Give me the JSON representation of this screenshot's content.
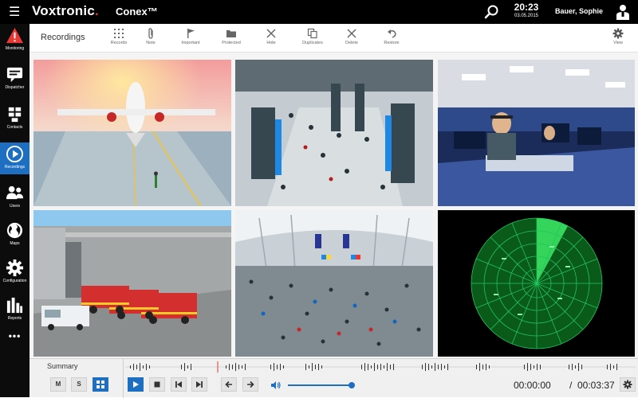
{
  "header": {
    "brand_name": "Voxtronic",
    "brand_dot": ".",
    "product": "Conex™",
    "time": "20:23",
    "date": "03.05.2015",
    "user": "Bauer, Sophie",
    "menu_icon": "hamburger-icon",
    "search_icon": "search-icon",
    "user_icon": "user-icon"
  },
  "sidebar": {
    "items": [
      {
        "label": "Monitoring",
        "icon": "alert-icon",
        "active": false
      },
      {
        "label": "Dispatcher",
        "icon": "chat-icon",
        "active": false
      },
      {
        "label": "Contacts",
        "icon": "contacts-icon",
        "active": false
      },
      {
        "label": "Recordings",
        "icon": "play-circle-icon",
        "active": true
      },
      {
        "label": "Users",
        "icon": "users-icon",
        "active": false
      },
      {
        "label": "Maps",
        "icon": "globe-icon",
        "active": false
      },
      {
        "label": "Configuration",
        "icon": "gear-icon",
        "active": false
      },
      {
        "label": "Reports",
        "icon": "bar-chart-icon",
        "active": false
      }
    ],
    "more": "•••"
  },
  "toolbar": {
    "title": "Recordings",
    "buttons": [
      {
        "label": "Records",
        "icon": "grid-dots-icon"
      },
      {
        "label": "Note",
        "icon": "paperclip-icon"
      },
      {
        "label": "Important",
        "icon": "flag-icon"
      },
      {
        "label": "Protected",
        "icon": "folder-icon"
      },
      {
        "label": "Hide",
        "icon": "cross-icon"
      },
      {
        "label": "Duplicates",
        "icon": "duplicate-icon"
      },
      {
        "label": "Delete",
        "icon": "cross-icon"
      },
      {
        "label": "Restore",
        "icon": "undo-icon"
      },
      {
        "label": "View",
        "icon": "gear-icon"
      }
    ]
  },
  "tiles": [
    {
      "name": "airport-apron-aircraft"
    },
    {
      "name": "security-checkpoint"
    },
    {
      "name": "control-room-operator"
    },
    {
      "name": "fire-trucks-airfield"
    },
    {
      "name": "airport-terminal-hall"
    },
    {
      "name": "radar-screen"
    }
  ],
  "bottom": {
    "summary": "Summary",
    "mode_m": "M",
    "mode_s": "S",
    "current_time": "00:00:00",
    "separator": "/",
    "total_time": "00:03:37"
  },
  "colors": {
    "accent": "#1e6fc1",
    "brand_red": "#e53935",
    "radar_green": "#22c55e"
  }
}
